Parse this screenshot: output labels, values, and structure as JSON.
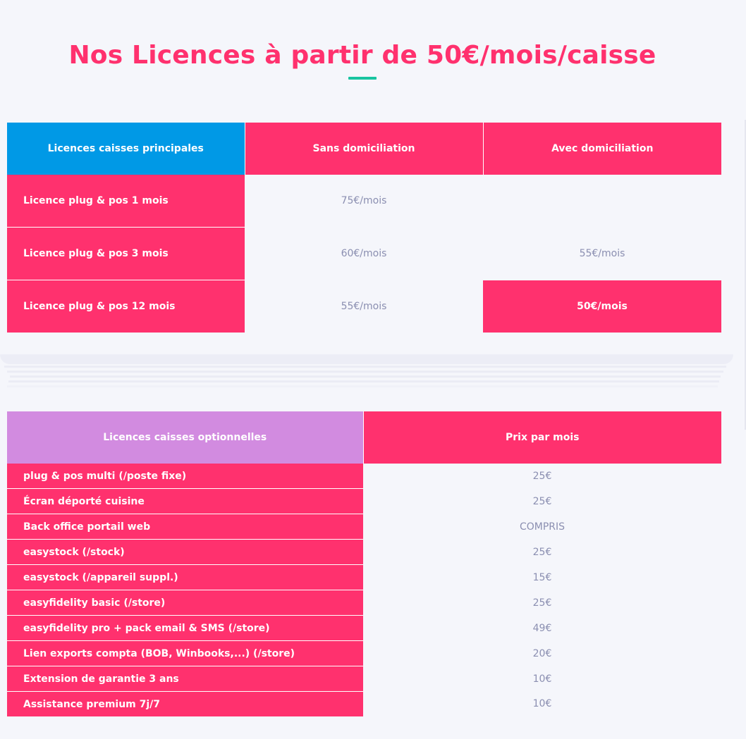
{
  "title": "Nos Licences à partir de 50€/mois/caisse",
  "main_table": {
    "headers": [
      "Licences caisses principales",
      "Sans domiciliation",
      "Avec domiciliation"
    ],
    "rows": [
      {
        "label": "Licence plug & pos 1 mois",
        "sans": "75€/mois",
        "avec": ""
      },
      {
        "label": "Licence plug & pos 3 mois",
        "sans": "60€/mois",
        "avec": "55€/mois"
      },
      {
        "label": "Licence plug & pos 12 mois",
        "sans": "55€/mois",
        "avec": "50€/mois"
      }
    ]
  },
  "options_table": {
    "headers": [
      "Licences caisses optionnelles",
      "Prix par mois"
    ],
    "rows": [
      {
        "label": "plug & pos multi (/poste fixe)",
        "price": "25€"
      },
      {
        "label": "Écran déporté cuisine",
        "price": "25€"
      },
      {
        "label": "Back office portail web",
        "price": "COMPRIS"
      },
      {
        "label": "easystock (/stock)",
        "price": "25€"
      },
      {
        "label": "easystock (/appareil suppl.)",
        "price": "15€"
      },
      {
        "label": "easyfidelity basic (/store)",
        "price": "25€"
      },
      {
        "label": "easyfidelity pro + pack email & SMS (/store)",
        "price": "49€"
      },
      {
        "label": "Lien exports compta (BOB, Winbooks,...) (/store)",
        "price": "20€"
      },
      {
        "label": "Extension de garantie 3 ans",
        "price": "10€"
      },
      {
        "label": "Assistance premium 7j/7",
        "price": "10€"
      }
    ]
  },
  "colors": {
    "pink": "#ff316e",
    "blue": "#0099e6",
    "lavender": "#d28be0",
    "accent_teal": "#18c4a0",
    "muted_text": "#8b8fb1",
    "background": "#f5f6fb"
  }
}
